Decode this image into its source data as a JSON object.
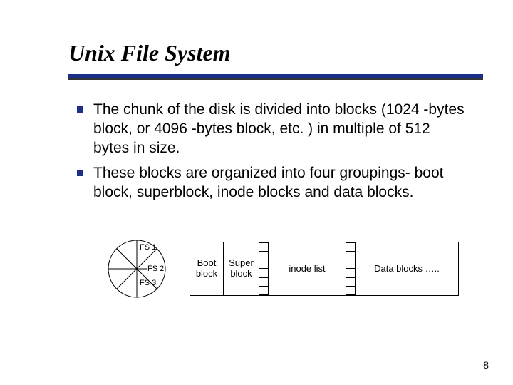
{
  "title": "Unix File System",
  "bullets": [
    "The chunk of the disk is divided into blocks (1024 -bytes block, or 4096 -bytes block, etc. ) in multiple of 512 bytes in size.",
    "These blocks are organized into four groupings- boot block, superblock, inode blocks and data blocks."
  ],
  "circle": {
    "fs1": "FS 1",
    "fs2": "FS 2",
    "fs3": "FS 3"
  },
  "blocks": {
    "boot": "Boot block",
    "super": "Super block",
    "inode": "inode list",
    "data": "Data blocks ….."
  },
  "page_number": "8"
}
